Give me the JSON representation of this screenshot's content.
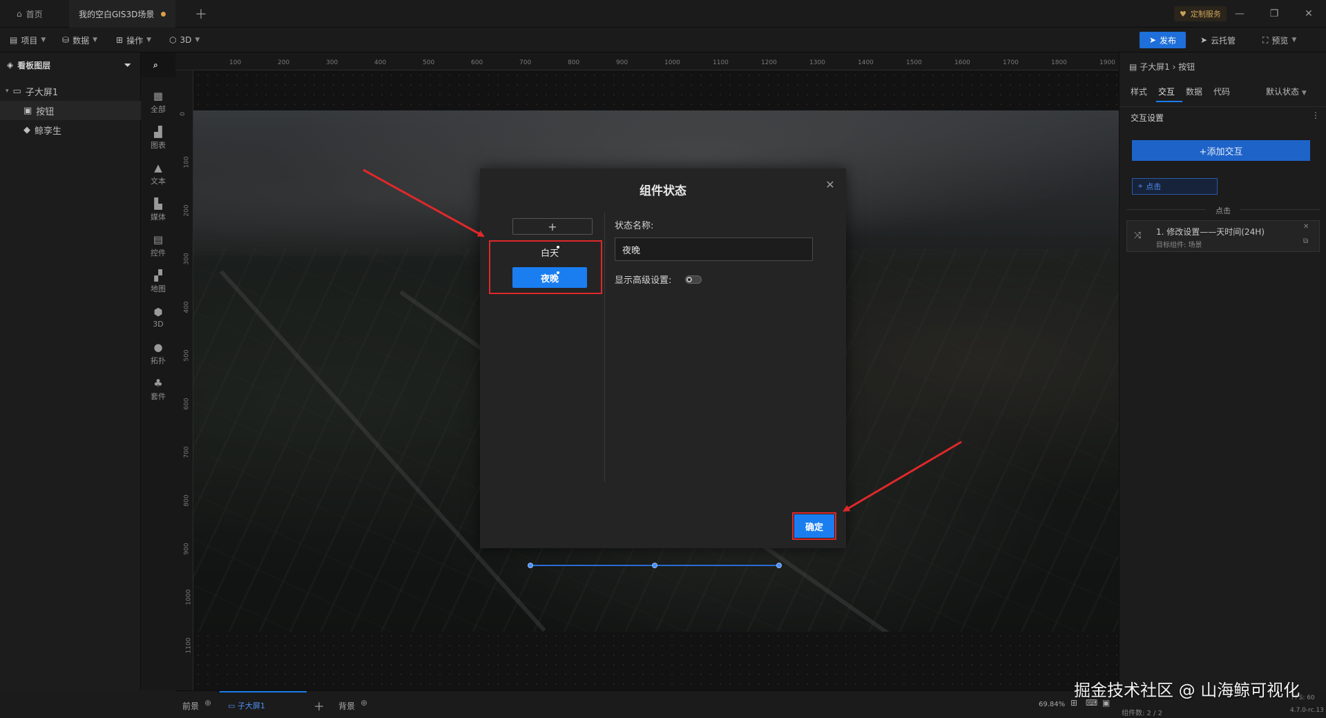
{
  "titlebar": {
    "home_label": "首页",
    "scene_tab": "我的空白GIS3D场景",
    "custom_service": "定制服务"
  },
  "menubar": {
    "project": "项目",
    "data": "数据",
    "operate": "操作",
    "threed": "3D",
    "publish": "发布",
    "cloud": "云托管",
    "preview": "预览"
  },
  "left_panel": {
    "header": "看板图层",
    "items": [
      {
        "label": "子大屏1"
      },
      {
        "label": "按钮"
      },
      {
        "label": "鲸孪生"
      }
    ]
  },
  "tools": [
    {
      "label": "全部",
      "icon": "grid-icon"
    },
    {
      "label": "图表",
      "icon": "bar-chart-icon"
    },
    {
      "label": "文本",
      "icon": "text-icon"
    },
    {
      "label": "媒体",
      "icon": "media-icon"
    },
    {
      "label": "控件",
      "icon": "widget-icon"
    },
    {
      "label": "地图",
      "icon": "map-icon"
    },
    {
      "label": "3D",
      "icon": "cube-icon"
    },
    {
      "label": "拓扑",
      "icon": "topology-icon"
    },
    {
      "label": "套件",
      "icon": "kit-icon"
    }
  ],
  "ruler": {
    "h_ticks": [
      "100",
      "200",
      "300",
      "400",
      "500",
      "600",
      "700",
      "800",
      "900",
      "1000",
      "1100",
      "1200",
      "1300",
      "1400",
      "1500",
      "1600",
      "1700",
      "1800",
      "1900"
    ],
    "v_ticks": [
      "0",
      "100",
      "200",
      "300",
      "400",
      "500",
      "600",
      "700",
      "800",
      "900",
      "1000",
      "1100"
    ]
  },
  "dialog": {
    "title": "组件状态",
    "add_symbol": "+",
    "states": [
      {
        "label": "白天"
      },
      {
        "label": "夜晚"
      }
    ],
    "name_label": "状态名称:",
    "name_value": "夜晚",
    "advanced_label": "显示高级设置:",
    "ok_label": "确定"
  },
  "right_panel": {
    "breadcrumb": "子大屏1 › 按钮",
    "tabs": [
      "样式",
      "交互",
      "数据",
      "代码"
    ],
    "default_state": "默认状态",
    "section": "交互设置",
    "add_interaction": "+添加交互",
    "trigger_tag": "点击",
    "trigger_label": "点击",
    "action_title": "1. 修改设置——天时间(24H)",
    "action_sub": "目标组件: 场景"
  },
  "bottom": {
    "foreground": "前景",
    "screen_tab": "子大屏1",
    "background": "背景",
    "zoom": "69.84%",
    "component_count": "组件数: 2 / 2",
    "version": "4.7.0-rc.13",
    "fps": "FPS: 60"
  },
  "watermark": "掘金技术社区 @ 山海鲸可视化",
  "colors": {
    "accent": "#1a7ef0",
    "highlight": "#e0282a",
    "dirty_dot": "#d9a04a"
  }
}
